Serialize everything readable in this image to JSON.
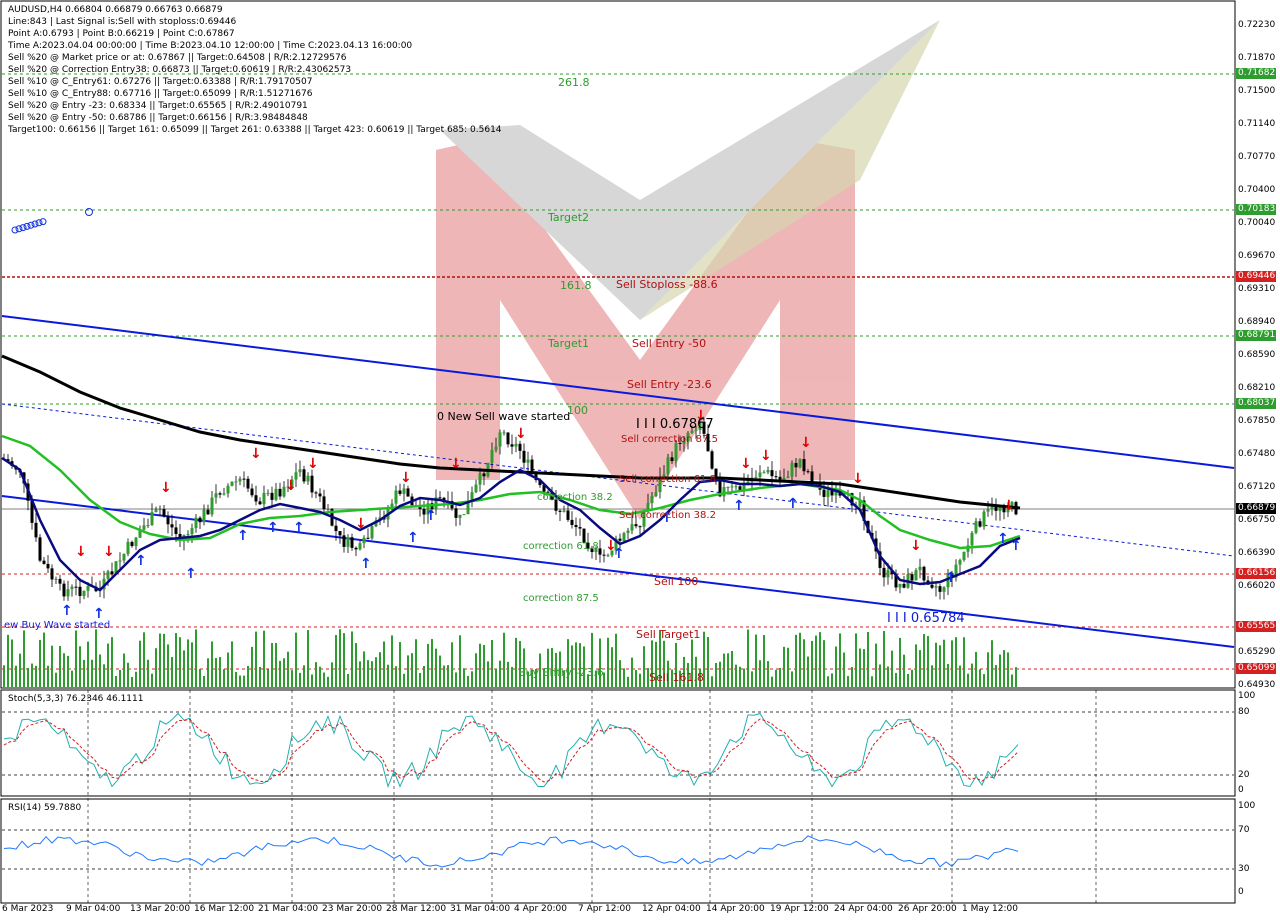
{
  "header": {
    "symbol_line": "AUDUSD,H4  0.66804 0.66879 0.66763 0.66879",
    "info": [
      "Line:843 | Last Signal is:Sell with stoploss:0.69446",
      "Point A:0.6793 | Point B:0.66219 | Point C:0.67867",
      "Time A:2023.04.04 00:00:00 | Time B:2023.04.10 12:00:00 | Time C:2023.04.13 16:00:00",
      "Sell %20 @ Market price or at: 0.67867 || Target:0.64508 | R/R:2.12729576",
      "Sell %20 @ Correction Entry38: 0.66873 || Target:0.60619 | R/R:2.43062573",
      "Sell %10 @ C_Entry61: 0.67276 || Target:0.63388 | R/R:1.79170507",
      "Sell %10 @ C_Entry88: 0.67716 || Target:0.65099 | R/R:1.51271676",
      "Sell %20 @ Entry -23: 0.68334 || Target:0.65565 | R/R:2.49010791",
      "Sell %20 @ Entry -50: 0.68786 || Target:0.66156 | R/R:3.98484848",
      "Target100: 0.66156 || Target 161: 0.65099 || Target 261: 0.63388 || Target 423: 0.60619 || Target 685: 0.5614"
    ]
  },
  "price_axis": [
    "0.72230",
    "0.71870",
    "0.71500",
    "0.71140",
    "0.70770",
    "0.70400",
    "0.70040",
    "0.69670",
    "0.69310",
    "0.68940",
    "0.68590",
    "0.68210",
    "0.67850",
    "0.67480",
    "0.67120",
    "0.66750",
    "0.66390",
    "0.66020",
    "0.65290",
    "0.64930"
  ],
  "price_tags": [
    {
      "value": "0.71682",
      "color": "#2e9c2e"
    },
    {
      "value": "0.70183",
      "color": "#2e9c2e"
    },
    {
      "value": "0.69446",
      "color": "#d42020"
    },
    {
      "value": "0.68791",
      "color": "#2e9c2e"
    },
    {
      "value": "0.68037",
      "color": "#2e9c2e"
    },
    {
      "value": "0.66879",
      "color": "#000000"
    },
    {
      "value": "0.66156",
      "color": "#d42020"
    },
    {
      "value": "0.65565",
      "color": "#d42020"
    },
    {
      "value": "0.65099",
      "color": "#d42020"
    }
  ],
  "chart_labels": {
    "l2618": "261.8",
    "target2": "Target2",
    "l1618": "161.8",
    "sell_stoploss": "Sell Stoploss -88.6",
    "target1": "Target1",
    "sell_entry_50": "Sell Entry -50",
    "sell_entry_236": "Sell Entry -23.6",
    "l100": "100",
    "new_sell_wave": "0 New Sell wave started",
    "point_c": "I I I 0.67867",
    "sell_corr_875": "Sell correction 87.5",
    "sell_corr_618": "Sell correction 61.8",
    "sell_corr_382": "Sell correction 38.2",
    "correction_382": "correction 38.2",
    "correction_618": "correction 61.8",
    "correction_875": "correction 87.5",
    "sell_100": "Sell 100",
    "point_b": "I I I 0.65784",
    "new_buy_wave": "ew Buy Wave started",
    "sell_target1": "Sell Target1",
    "buy_entry": "Buy Entry -23.6",
    "sell_1618": "Sell 161.8"
  },
  "stoch": {
    "title": "Stoch(5,3,3) 76.2346 46.1111",
    "levels": [
      "100",
      "80",
      "20",
      "0"
    ]
  },
  "rsi": {
    "title": "RSI(14) 59.7880",
    "levels": [
      "100",
      "70",
      "30",
      "0"
    ]
  },
  "dates": [
    "6 Mar 2023",
    "9 Mar 04:00",
    "13 Mar 20:00",
    "16 Mar 12:00",
    "21 Mar 04:00",
    "23 Mar 20:00",
    "28 Mar 12:00",
    "31 Mar 04:00",
    "4 Apr 20:00",
    "7 Apr 12:00",
    "12 Apr 04:00",
    "14 Apr 20:00",
    "19 Apr 12:00",
    "24 Apr 04:00",
    "26 Apr 20:00",
    "1 May 12:00"
  ],
  "colors": {
    "bull": "#2e9c2e",
    "bear": "#d42020",
    "channel": "#0a1adc",
    "ma_black": "#000000",
    "ma_green": "#22c022",
    "ma_navy": "#0a0a80"
  }
}
